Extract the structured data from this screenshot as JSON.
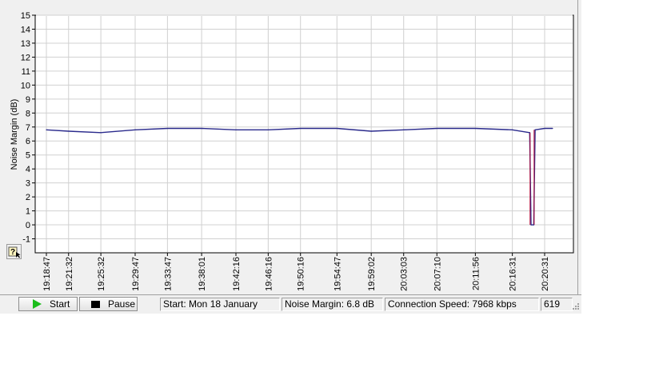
{
  "chart_data": {
    "type": "line",
    "ylabel": "Noise Margin (dB)",
    "xlabel": "",
    "ylim": [
      -2,
      15
    ],
    "yticks": [
      -1,
      0,
      1,
      2,
      3,
      4,
      5,
      6,
      7,
      8,
      9,
      10,
      11,
      12,
      13,
      14,
      15
    ],
    "x_categories": [
      "19:18:47",
      "19:21:32",
      "19:25:32",
      "19:29:47",
      "19:33:47",
      "19:38:01",
      "19:42:16",
      "19:46:16",
      "19:50:16",
      "19:54:47",
      "19:59:02",
      "20:03:03",
      "20:07:10",
      "20:11:56",
      "20:16:31",
      "20:20:31"
    ],
    "grid": true,
    "series": [
      {
        "color": "#2a2a8c",
        "points": [
          {
            "t": "19:18:47",
            "y": 6.8
          },
          {
            "t": "19:21:32",
            "y": 6.7
          },
          {
            "t": "19:25:32",
            "y": 6.6
          },
          {
            "t": "19:29:47",
            "y": 6.8
          },
          {
            "t": "19:33:47",
            "y": 6.9
          },
          {
            "t": "19:38:01",
            "y": 6.9
          },
          {
            "t": "19:42:16",
            "y": 6.8
          },
          {
            "t": "19:46:16",
            "y": 6.8
          },
          {
            "t": "19:50:16",
            "y": 6.9
          },
          {
            "t": "19:54:47",
            "y": 6.9
          },
          {
            "t": "19:59:02",
            "y": 6.7
          },
          {
            "t": "20:03:03",
            "y": 6.8
          },
          {
            "t": "20:07:10",
            "y": 6.9
          },
          {
            "t": "20:11:56",
            "y": 6.9
          },
          {
            "t": "20:16:31",
            "y": 6.8
          },
          {
            "t": "20:18:40",
            "y": 6.6
          },
          {
            "t": "20:18:50",
            "y": 0.0
          },
          {
            "t": "20:19:10",
            "y": 0.0
          },
          {
            "t": "20:19:20",
            "y": 6.8
          },
          {
            "t": "20:20:31",
            "y": 6.9
          },
          {
            "t": "20:21:30",
            "y": 6.9
          }
        ]
      }
    ]
  },
  "statusbar": {
    "start_label": "Start",
    "pause_label": "Pause",
    "start_time": "Start: Mon 18 January",
    "noise_margin": "Noise Margin: 6.8 dB",
    "connection_speed": "Connection Speed: 7968 kbps",
    "count": "619"
  },
  "colors": {
    "line": "#2a2a8c",
    "line_drop": "#b00030",
    "grid": "#d0d0d0",
    "plot_bg": "#ffffff",
    "window_bg": "#f0f0f0"
  },
  "icons": {
    "help": "help-cursor-icon",
    "start": "play-icon",
    "pause": "stop-square-icon",
    "grip": "resize-grip-icon"
  }
}
